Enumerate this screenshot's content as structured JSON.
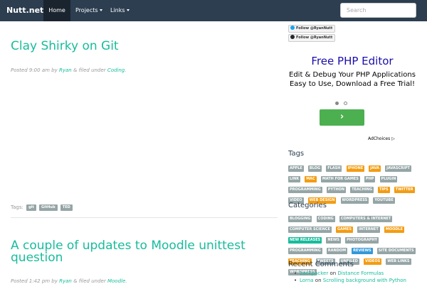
{
  "navbar": {
    "brand": "Nutt.net",
    "items": [
      {
        "label": "Home"
      },
      {
        "label": "Projects"
      },
      {
        "label": "Links"
      }
    ],
    "search_placeholder": "Search"
  },
  "posts": [
    {
      "title": "Clay Shirky on Git",
      "meta_prefix": "Posted 9:00 am by",
      "author": "Ryan",
      "meta_mid": "& filed under",
      "category": "Coding",
      "meta_suffix": ".",
      "tags_label": "Tags:",
      "tags": [
        "git",
        "GitHub",
        "TED"
      ]
    },
    {
      "title": "A couple of updates to Moodle unittest question",
      "meta_prefix": "Posted 1:42 pm by",
      "author": "Ryan",
      "meta_mid": "& filed under",
      "category": "Moodle",
      "meta_suffix": "."
    }
  ],
  "sidebar": {
    "follow_twitter": "Follow @RyanNutt",
    "follow_github": "Follow @RyanNutt",
    "ad": {
      "headline": "Free PHP Editor",
      "body": "Edit & Debug Your PHP Applications Easy to Use, Download a Free Trial!",
      "button_glyph": "›",
      "adchoices": "AdChoices"
    },
    "tags_heading": "Tags",
    "tags": [
      {
        "text": "APPLE",
        "color": "#95a5a6"
      },
      {
        "text": "BLOG",
        "color": "#95a5a6"
      },
      {
        "text": "FLASH",
        "color": "#95a5a6"
      },
      {
        "text": "IPHONE",
        "color": "#f39c12"
      },
      {
        "text": "JAVA",
        "color": "#f39c12"
      },
      {
        "text": "JAVASCRIPT",
        "color": "#95a5a6"
      },
      {
        "text": "LINK",
        "color": "#95a5a6"
      },
      {
        "text": "MAC",
        "color": "#f39c12"
      },
      {
        "text": "MATH FOR GAMES",
        "color": "#95a5a6"
      },
      {
        "text": "PHP",
        "color": "#95a5a6"
      },
      {
        "text": "PLUGIN",
        "color": "#95a5a6"
      },
      {
        "text": "PROGRAMMING",
        "color": "#95a5a6"
      },
      {
        "text": "PYTHON",
        "color": "#95a5a6"
      },
      {
        "text": "TEACHING",
        "color": "#95a5a6"
      },
      {
        "text": "TIPS",
        "color": "#f39c12"
      },
      {
        "text": "TWITTER",
        "color": "#f39c12"
      },
      {
        "text": "VIDEO",
        "color": "#95a5a6"
      },
      {
        "text": "WEB DESIGN",
        "color": "#f39c12"
      },
      {
        "text": "WORDPRESS",
        "color": "#95a5a6"
      },
      {
        "text": "YOUTUBE",
        "color": "#95a5a6"
      }
    ],
    "categories_heading": "Categories",
    "categories": [
      {
        "text": "BLOGGING",
        "color": "#95a5a6"
      },
      {
        "text": "CODING",
        "color": "#95a5a6"
      },
      {
        "text": "COMPUTERS & INTERNET",
        "color": "#95a5a6"
      },
      {
        "text": "COMPUTER SCIENCE",
        "color": "#95a5a6"
      },
      {
        "text": "GAMES",
        "color": "#f39c12"
      },
      {
        "text": "INTERNET",
        "color": "#95a5a6"
      },
      {
        "text": "MOODLE",
        "color": "#f39c12"
      },
      {
        "text": "NEW RELEASES",
        "color": "#18bc9c"
      },
      {
        "text": "NEWS",
        "color": "#95a5a6"
      },
      {
        "text": "PHOTOGRAPHY",
        "color": "#95a5a6"
      },
      {
        "text": "PROGRAMMING",
        "color": "#95a5a6"
      },
      {
        "text": "RANDOM",
        "color": "#95a5a6"
      },
      {
        "text": "REVIEWS",
        "color": "#3498db"
      },
      {
        "text": "SITE DOCUMENTS",
        "color": "#95a5a6"
      },
      {
        "text": "TEACHING",
        "color": "#f39c12"
      },
      {
        "text": "TWEETS",
        "color": "#95a5a6"
      },
      {
        "text": "UNFILED",
        "color": "#95a5a6"
      },
      {
        "text": "VIDEOS",
        "color": "#f39c12"
      },
      {
        "text": "WEB LINKS",
        "color": "#95a5a6"
      },
      {
        "text": "WORDPRESS",
        "color": "#95a5a6"
      }
    ],
    "comments_heading": "Recent Comments",
    "comments": [
      {
        "author": "backpacker",
        "on": "on",
        "post": "Distance Formulas"
      },
      {
        "author": "Lorna",
        "on": "on",
        "post": "Scrolling background with Python"
      }
    ]
  }
}
